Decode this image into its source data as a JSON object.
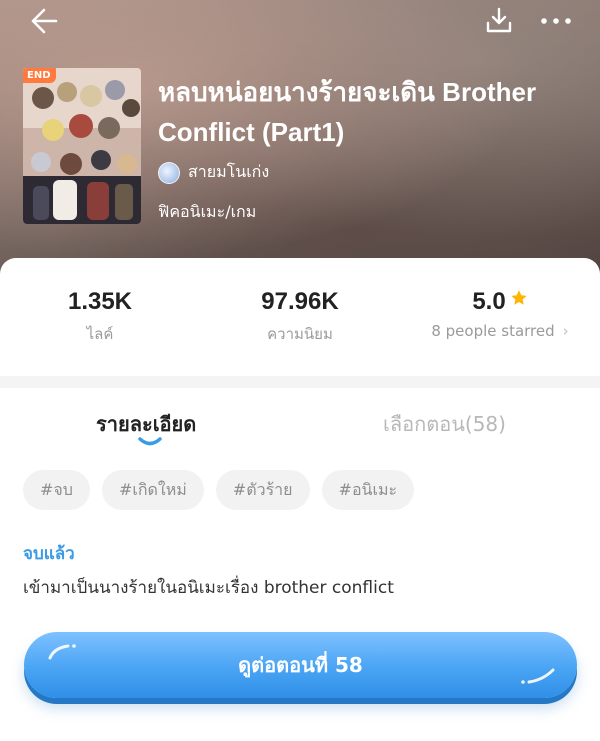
{
  "header": {
    "back_icon": "arrow-left-icon",
    "download_icon": "download-icon",
    "more_icon": "more-horizontal-icon"
  },
  "book": {
    "badge": "END",
    "title": "หลบหน่อยนางร้ายจะเดิน Brother Conflict (Part1)",
    "author": "สายมโนเก่ง",
    "genre": "ฟิคอนิเมะ/เกม"
  },
  "stats": {
    "likes": {
      "value": "1.35K",
      "label": "ไลค์"
    },
    "popularity": {
      "value": "97.96K",
      "label": "ความนิยม"
    },
    "rating": {
      "value": "5.0",
      "label": "8 people starred",
      "star_color": "#ffb400"
    }
  },
  "tabs": [
    {
      "label": "รายละเอียด",
      "active": true
    },
    {
      "label": "เลือกตอน(58)",
      "active": false
    }
  ],
  "tags": [
    "#จบ",
    "#เกิดใหม่",
    "#ตัวร้าย",
    "#อนิเมะ"
  ],
  "status": "จบแล้ว",
  "description": "เข้ามาเป็นนางร้ายในอนิเมะเรื่อง brother conflict",
  "cta": {
    "label": "ดูต่อตอนที่ 58"
  },
  "colors": {
    "accent": "#3a9be6",
    "button": "#4aa4f4",
    "badge": "#ff7a3c"
  }
}
